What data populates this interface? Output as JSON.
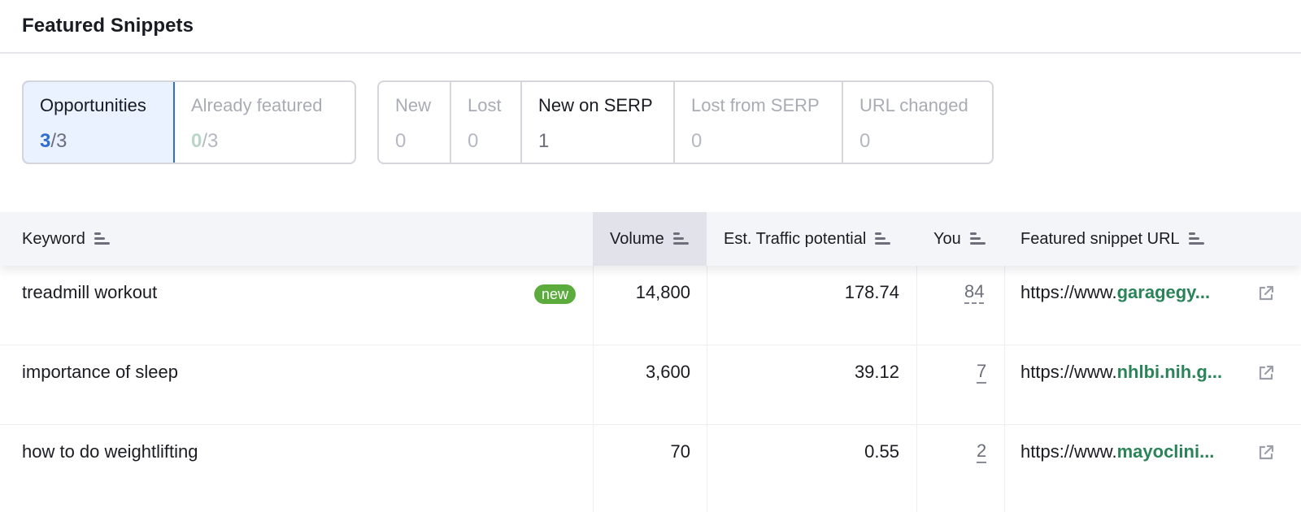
{
  "page": {
    "title": "Featured Snippets"
  },
  "tabs_primary": [
    {
      "label": "Opportunities",
      "value": "3",
      "total": "/3",
      "active": true
    },
    {
      "label": "Already featured",
      "value": "0",
      "total": "/3",
      "active": false
    }
  ],
  "tabs_changes": [
    {
      "label": "New",
      "value": "0"
    },
    {
      "label": "Lost",
      "value": "0"
    },
    {
      "label": "New on SERP",
      "value": "1"
    },
    {
      "label": "Lost from SERP",
      "value": "0"
    },
    {
      "label": "URL changed",
      "value": "0"
    }
  ],
  "table": {
    "columns": [
      "Keyword",
      "Volume",
      "Est. Traffic potential",
      "You",
      "Featured snippet URL"
    ],
    "sorted_column": "Volume",
    "rows": [
      {
        "keyword": "treadmill workout",
        "badge": "new",
        "volume": "14,800",
        "traffic": "178.74",
        "you": "84",
        "url_prefix": "https://www.",
        "url_domain": "garagegy..."
      },
      {
        "keyword": "importance of sleep",
        "badge": "",
        "volume": "3,600",
        "traffic": "39.12",
        "you": "7",
        "url_prefix": "https://www.",
        "url_domain": "nhlbi.nih.g..."
      },
      {
        "keyword": "how to do weightlifting",
        "badge": "",
        "volume": "70",
        "traffic": "0.55",
        "you": "2",
        "url_prefix": "https://www.",
        "url_domain": "mayoclini..."
      }
    ]
  },
  "icons": {
    "sort": "sort-bars-icon",
    "external": "external-link-icon"
  },
  "colors": {
    "accent": "#2f6dcf",
    "active_bg": "#e9f2fe",
    "badge_green": "#5cac3d",
    "domain_green": "#2b8459"
  }
}
